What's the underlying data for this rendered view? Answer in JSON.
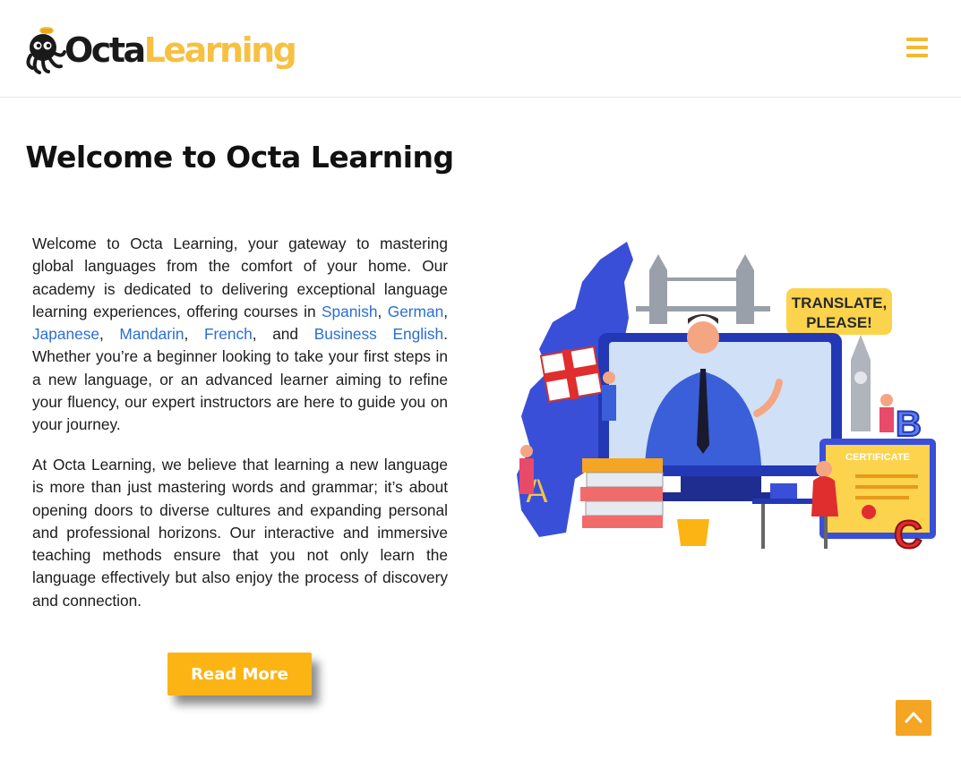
{
  "header": {
    "logo_part1": "Octa",
    "logo_part2": "Learning",
    "menu_icon": "hamburger-menu-icon"
  },
  "main": {
    "title": "Welcome to Octa Learning",
    "p1": {
      "before": "Welcome to Octa Learning, your gateway to mastering global languages from the comfort of your home. Our academy is dedicated to delivering exceptional language learning experiences, offering courses in ",
      "links": [
        "Spanish",
        "German",
        "Japanese",
        "Mandarin",
        "French",
        "Business English"
      ],
      "sep": ", ",
      "and": ", and ",
      "after": ". Whether you’re a beginner looking to take your first steps in a new language, or an advanced learner aiming to refine your fluency, our expert instructors are here to guide you on your journey."
    },
    "p2": "At Octa Learning, we believe that learning a new language is more than just mastering words and grammar; it’s about opening doors to diverse cultures and expanding personal and professional horizons. Our interactive and immersive teaching methods ensure that you not only learn the language effectively but also enjoy the process of discovery and connection.",
    "read_more": "Read More"
  },
  "illustration": {
    "translate_badge_line1": "TRANSLATE,",
    "translate_badge_line2": "PLEASE!",
    "certificate_label": "CERTIFICATE",
    "letter_a": "A",
    "letter_b": "B",
    "letter_c": "C"
  },
  "scroll_top_icon": "chevron-up-icon",
  "colors": {
    "accent": "#fcb414",
    "logo_yellow": "#f6c142",
    "link": "#2b6fd1",
    "illustration_blue": "#3a4fd8"
  }
}
